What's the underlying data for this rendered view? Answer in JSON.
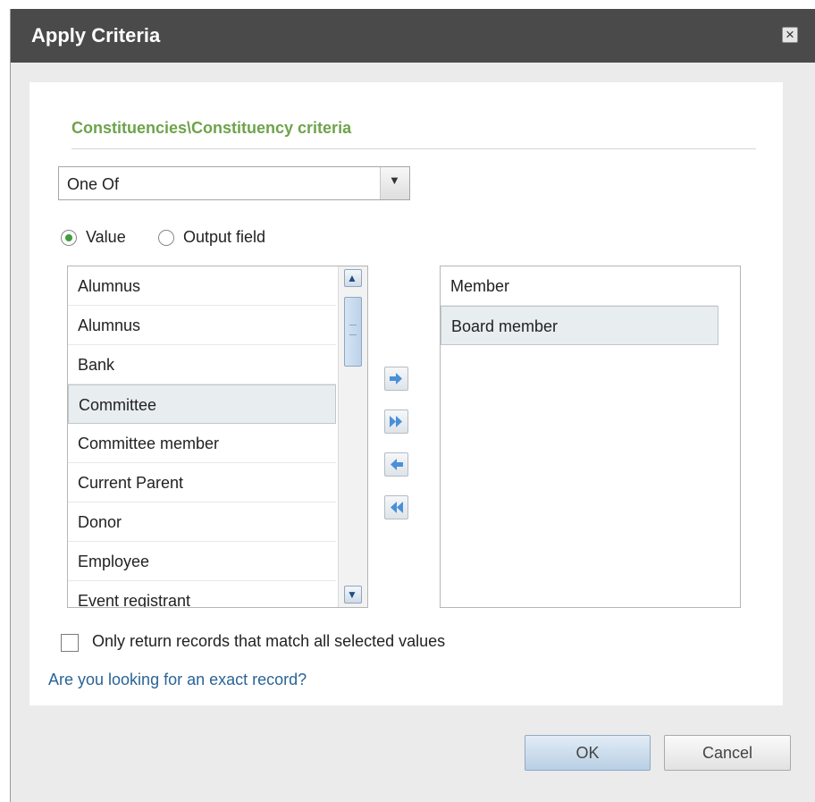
{
  "window": {
    "title": "Apply Criteria",
    "close_icon": "close-icon"
  },
  "criteria": {
    "section_title": "Constituencies\\Constituency criteria",
    "operator": {
      "selected": "One Of"
    },
    "mode": {
      "value_label": "Value",
      "output_field_label": "Output field",
      "selected": "Value"
    }
  },
  "available_list": {
    "items": [
      "Alumnus",
      "Alumnus",
      "Bank",
      "Committee",
      "Committee member",
      "Current Parent",
      "Donor",
      "Employee",
      "Event registrant"
    ],
    "selected_item": "Committee"
  },
  "selected_list": {
    "items": [
      "Member",
      "Board member"
    ],
    "selected_item": "Board member"
  },
  "move_buttons": {
    "add_icon": "arrow-right-icon",
    "add_all_icon": "double-arrow-right-icon",
    "remove_icon": "arrow-left-icon",
    "remove_all_icon": "double-arrow-left-icon"
  },
  "options": {
    "match_all_label": "Only return records that match all selected values",
    "match_all_checked": false,
    "exact_record_link": "Are you looking for an exact record?"
  },
  "footer": {
    "ok_label": "OK",
    "cancel_label": "Cancel"
  },
  "colors": {
    "titlebar": "#4a4a4a",
    "section_title": "#6ea34b",
    "link": "#2a6496",
    "radio_selected": "#3e9e3a"
  }
}
